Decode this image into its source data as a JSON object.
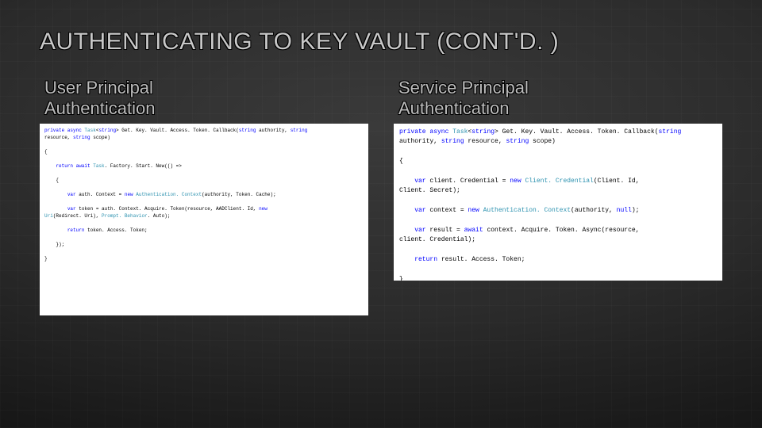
{
  "title": "AUTHENTICATING TO KEY VAULT (CONT'D. )",
  "left": {
    "heading_line1": "User  Principal",
    "heading_line2": "Authentication"
  },
  "right": {
    "heading_line1": "Service  Principal",
    "heading_line2": "Authentication"
  },
  "code_left": {
    "sig_kw1": "private async ",
    "sig_type": "Task",
    "sig_generic_open": "<",
    "sig_kw_string": "string",
    "sig_generic_close": "> ",
    "sig_name": "Get. Key. Vault. Access. Token. Callback(",
    "sig_kw_p1": "string",
    "sig_p1": " authority, ",
    "sig_kw_p2": "string",
    "sig_end": "",
    "sig_line2a": "resource, ",
    "sig_kw_p3": "string",
    "sig_line2b": " scope)",
    "brace_open": "{",
    "ret_kw": "return await ",
    "ret_type": "Task",
    "ret_rest": ". Factory. Start. New(() =>",
    "lambda_open": "{",
    "auth_kw_var": "var",
    "auth_decl": " auth. Context = ",
    "auth_kw_new": "new ",
    "auth_type": "Authentication. Context",
    "auth_rest": "(authority, Token. Cache);",
    "tok_kw_var": "var",
    "tok_decl": " token = auth. Context. Acquire. Token(resource, AADClient. Id, ",
    "tok_kw_new": "new",
    "tok_line2a": "Uri",
    "tok_line2b": "(Redirect. Uri), ",
    "tok_type2": "Prompt. Behavior",
    "tok_line2c": ". Auto);",
    "return_tok_kw": "return",
    "return_tok": " token. Access. Token;",
    "lambda_close": "});",
    "brace_close": "}"
  },
  "code_right": {
    "sig_kw1": "private async ",
    "sig_type": "Task",
    "sig_generic_open": "<",
    "sig_kw_string": "string",
    "sig_generic_close": "> ",
    "sig_name": "Get. Key. Vault. Access. Token. Callback(",
    "sig_kw_p1": "string",
    "sig_line2a": "authority, ",
    "sig_kw_p2": "string",
    "sig_line2b": " resource, ",
    "sig_kw_p3": "string",
    "sig_line2c": " scope)",
    "brace_open": "{",
    "cc_kw_var": "var",
    "cc_decl": " client. Credential = ",
    "cc_kw_new": "new ",
    "cc_type": "Client. Credential",
    "cc_args": "(Client. Id,",
    "cc_line2": "Client. Secret);",
    "ctx_kw_var": "var",
    "ctx_decl": " context = ",
    "ctx_kw_new": "new ",
    "ctx_type": "Authentication. Context",
    "ctx_args": "(authority, ",
    "ctx_kw_null": "null",
    "ctx_end": ");",
    "res_kw_var": "var",
    "res_decl": " result = ",
    "res_kw_await": "await",
    "res_mid": " context. Acquire. Token. Async(resource,",
    "res_line2": "client. Credential);",
    "ret_kw": "return",
    "ret_rest": " result. Access. Token;",
    "brace_close": "}"
  }
}
